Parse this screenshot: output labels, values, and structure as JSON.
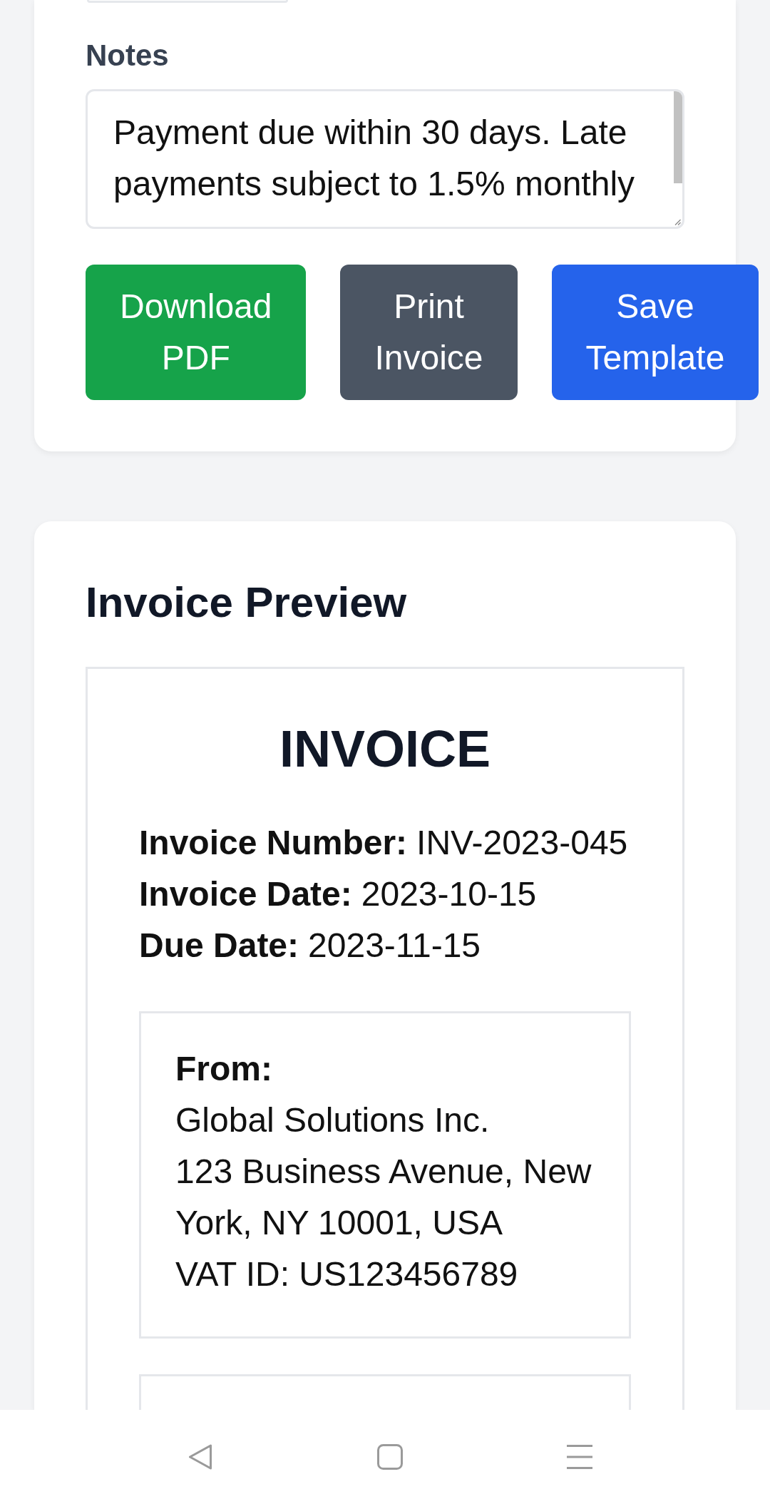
{
  "form": {
    "notes": {
      "label": "Notes",
      "value": "Payment due within 30 days. Late payments subject to 1.5% monthly"
    },
    "buttons": [
      {
        "label": "Download PDF",
        "kind": "download"
      },
      {
        "label": "Print Invoice",
        "kind": "print"
      },
      {
        "label": "Save Template",
        "kind": "save"
      }
    ]
  },
  "preview": {
    "title": "Invoice Preview",
    "document": {
      "heading": "INVOICE",
      "details": [
        {
          "label": "Invoice Number:",
          "value": "INV-2023-045"
        },
        {
          "label": "Invoice Date:",
          "value": "2023-10-15"
        },
        {
          "label": "Due Date:",
          "value": "2023-11-15"
        }
      ],
      "from": {
        "label": "From:",
        "lines": [
          "Global Solutions Inc.",
          "123 Business Avenue, New York, NY 10001, USA",
          "VAT ID: US123456789"
        ]
      }
    }
  }
}
